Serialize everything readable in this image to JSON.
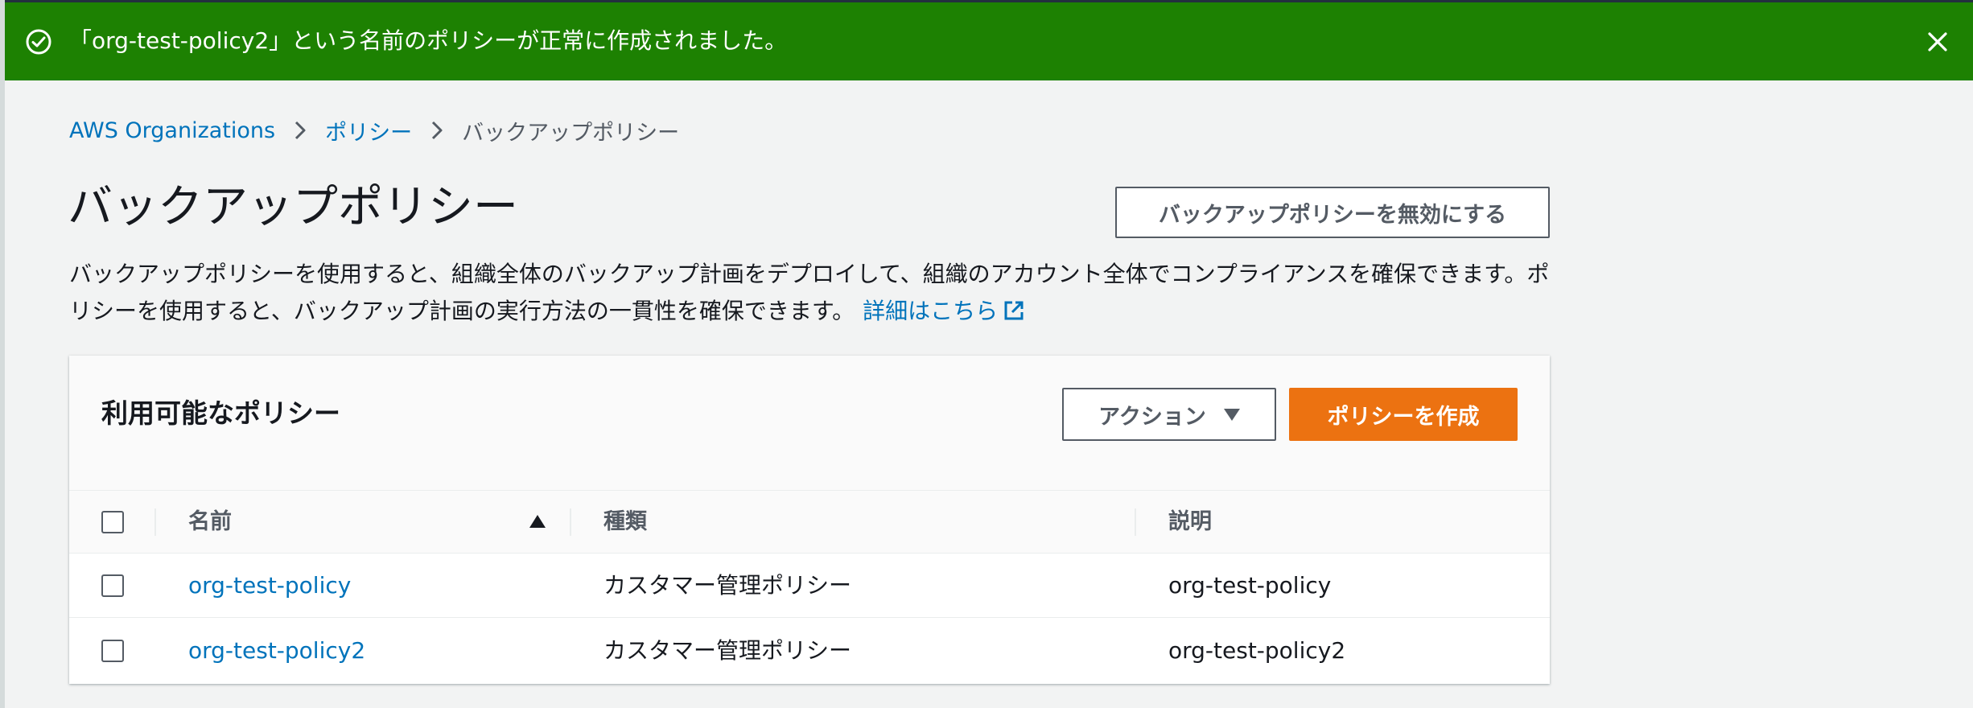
{
  "flash": {
    "message": "「org-test-policy2」という名前のポリシーが正常に作成されました。",
    "icon": "success-check-circle-icon",
    "close_icon": "close-icon",
    "color": "#1d8102"
  },
  "breadcrumb": {
    "items": [
      {
        "label": "AWS Organizations"
      },
      {
        "label": "ポリシー"
      }
    ],
    "current": "バックアップポリシー"
  },
  "page": {
    "title": "バックアップポリシー",
    "disable_button": "バックアップポリシーを無効にする",
    "description": "バックアップポリシーを使用すると、組織全体のバックアップ計画をデプロイして、組織のアカウント全体でコンプライアンスを確保できます。ポリシーを使用すると、バックアップ計画の実行方法の一貫性を確保できます。",
    "learn_more": "詳細はこちら"
  },
  "policies_panel": {
    "title": "利用可能なポリシー",
    "actions_button": "アクション",
    "create_button": "ポリシーを作成",
    "accent_color": "#ec7211",
    "columns": [
      "名前",
      "種類",
      "説明"
    ],
    "sort": {
      "column": "名前",
      "direction": "ascending"
    },
    "rows": [
      {
        "name": "org-test-policy",
        "type": "カスタマー管理ポリシー",
        "description": "org-test-policy"
      },
      {
        "name": "org-test-policy2",
        "type": "カスタマー管理ポリシー",
        "description": "org-test-policy2"
      }
    ]
  }
}
